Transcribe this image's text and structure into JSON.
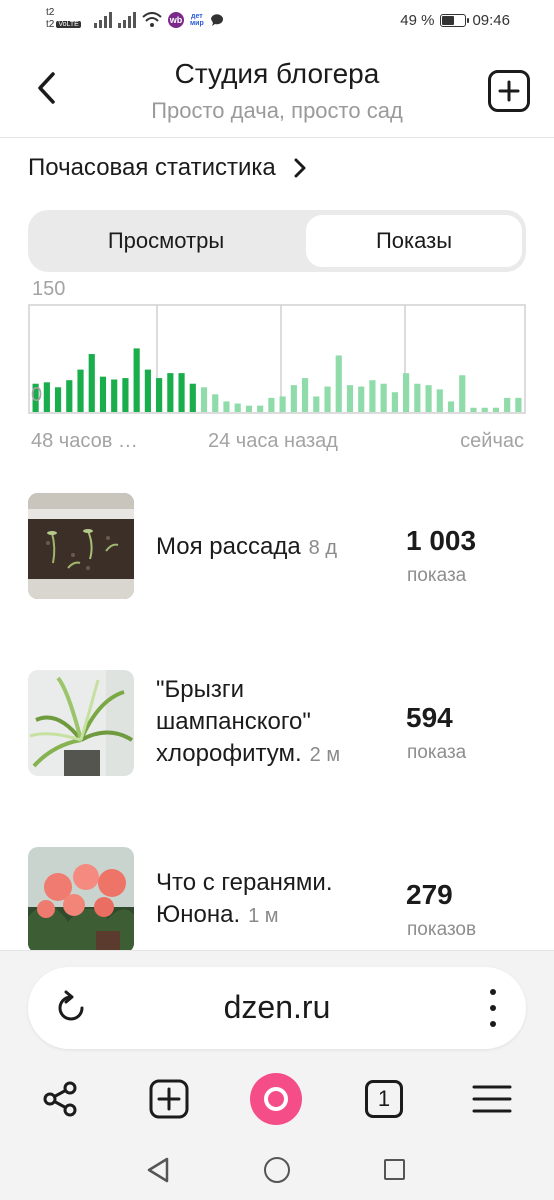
{
  "status_bar": {
    "carrier_1": "t2",
    "carrier_2": "t2",
    "volte": "VoLTE",
    "wb": "wb",
    "detmir_1": "дет",
    "detmir_2": "мир",
    "battery": "49 %",
    "battery_level": 0.49,
    "time": "09:46"
  },
  "header": {
    "title": "Студия блогера",
    "subtitle": "Просто дача, просто сад"
  },
  "section": {
    "title": "Почасовая статистика"
  },
  "tabs": [
    {
      "label": "Просмотры",
      "active": false
    },
    {
      "label": "Показы",
      "active": true
    }
  ],
  "chart_data": {
    "type": "bar",
    "ylim": [
      0,
      150
    ],
    "y_max_label": "150",
    "y_min_label": "0",
    "x_labels": [
      "48 часов …",
      "24 часа назад",
      "сейчас"
    ],
    "colors": {
      "recent_day": "#1aad4b",
      "older_day": "#8fdcaa"
    },
    "values": [
      40,
      42,
      35,
      45,
      60,
      82,
      50,
      46,
      48,
      90,
      60,
      48,
      55,
      55,
      40,
      35,
      25,
      15,
      12,
      9,
      9,
      20,
      22,
      38,
      48,
      22,
      36,
      80,
      38,
      36,
      45,
      40,
      28,
      55,
      40,
      38,
      32,
      15,
      52,
      6,
      6,
      6,
      20,
      20
    ],
    "recent_count": 15
  },
  "posts": [
    {
      "title": "Моя рассада",
      "age": "8 д",
      "count": "1 003",
      "unit": "показа"
    },
    {
      "title": "\"Брызги шампанского\" хлорофитум.",
      "age": "2 м",
      "count": "594",
      "unit": "показа"
    },
    {
      "title": "Что с геранями. Юнона.",
      "age": "1 м",
      "count": "279",
      "unit": "показов"
    }
  ],
  "browser": {
    "url": "dzen.ru",
    "tab_count": "1"
  }
}
